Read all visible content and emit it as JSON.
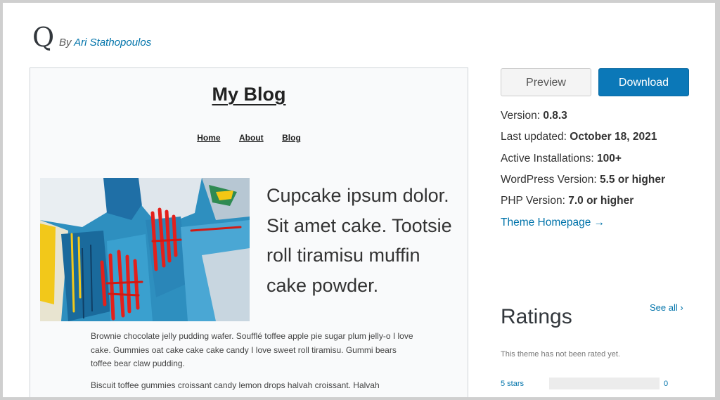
{
  "theme": {
    "name": "Q",
    "author_prefix": "By",
    "author": "Ari Stathopoulos"
  },
  "preview": {
    "blog_title": "My Blog",
    "nav": [
      "Home",
      "About",
      "Blog"
    ],
    "hero_text": "Cupcake ipsum dolor. Sit amet cake. Tootsie roll tiramisu muffin cake powder.",
    "paragraph1": "Brownie chocolate jelly pudding wafer. Soufflé toffee apple pie sugar plum jelly-o I love cake. Gummies oat cake cake cake candy I love sweet roll tiramisu. Gummi bears toffee bear claw pudding.",
    "paragraph2": "Biscuit toffee gummies croissant candy lemon drops halvah croissant. Halvah"
  },
  "actions": {
    "preview_label": "Preview",
    "download_label": "Download"
  },
  "details": {
    "version_label": "Version:",
    "version": "0.8.3",
    "updated_label": "Last updated:",
    "updated": "October 18, 2021",
    "installs_label": "Active Installations:",
    "installs": "100+",
    "wp_label": "WordPress Version:",
    "wp": "5.5 or higher",
    "php_label": "PHP Version:",
    "php": "7.0 or higher",
    "homepage": "Theme Homepage →"
  },
  "ratings": {
    "heading": "Ratings",
    "see_all": "See all",
    "chevron": "›",
    "none": "This theme has not been rated yet.",
    "rows": [
      {
        "label": "5 stars",
        "count": "0",
        "fraction": 0
      }
    ]
  },
  "colors": {
    "accent": "#0073aa",
    "download_bg": "#0b78b8"
  }
}
